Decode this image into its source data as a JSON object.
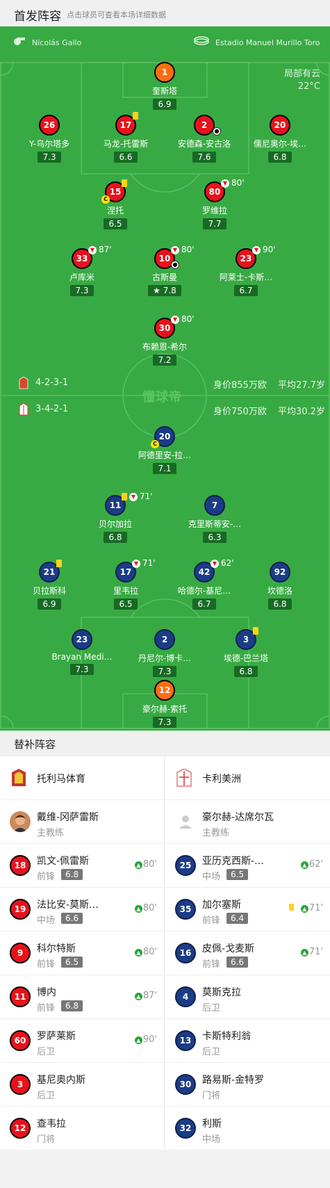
{
  "header": {
    "title": "首发阵容",
    "subtitle": "点击球员可查看本场详细数据"
  },
  "match": {
    "referee": "Nicolás Gallo",
    "stadium": "Estadio Manuel Murillo Toro",
    "weather": "局部有云",
    "temperature": "22°C",
    "watermark": "懂球帝"
  },
  "home_team": {
    "formation": "4-2-3-1",
    "value": "身价855万欧",
    "age": "平均27.7岁"
  },
  "away_team": {
    "formation": "3-4-2-1",
    "value": "身价750万欧",
    "age": "平均30.2岁"
  },
  "home_players": [
    {
      "num": "1",
      "name": "奎斯塔",
      "rating": "6.9"
    },
    {
      "num": "26",
      "name": "Y-乌尔塔多",
      "rating": "7.3"
    },
    {
      "num": "17",
      "name": "马龙-托雷斯",
      "rating": "6.6"
    },
    {
      "num": "2",
      "name": "安德森-安古洛",
      "rating": "7.6"
    },
    {
      "num": "20",
      "name": "儒尼奥尔-埃…",
      "rating": "6.8"
    },
    {
      "num": "15",
      "name": "涅托",
      "rating": "6.5"
    },
    {
      "num": "80",
      "name": "罗维拉",
      "rating": "7.7",
      "sub": "80'"
    },
    {
      "num": "33",
      "name": "卢库米",
      "rating": "7.3",
      "sub": "87'"
    },
    {
      "num": "10",
      "name": "古斯曼",
      "rating": "7.8",
      "sub": "80'"
    },
    {
      "num": "23",
      "name": "阿莱士-卡斯…",
      "rating": "6.7",
      "sub": "90'"
    },
    {
      "num": "30",
      "name": "布赖恩-希尔",
      "rating": "7.2",
      "sub": "80'"
    }
  ],
  "away_players": [
    {
      "num": "20",
      "name": "阿德里安-拉…",
      "rating": "7.1"
    },
    {
      "num": "11",
      "name": "贝尔加拉",
      "rating": "6.8",
      "sub": "71'"
    },
    {
      "num": "7",
      "name": "克里斯蒂安-…",
      "rating": "6.3"
    },
    {
      "num": "21",
      "name": "贝拉斯科",
      "rating": "6.9"
    },
    {
      "num": "17",
      "name": "里韦拉",
      "rating": "6.5",
      "sub": "71'"
    },
    {
      "num": "42",
      "name": "哈德尔-基尼…",
      "rating": "6.7",
      "sub": "62'"
    },
    {
      "num": "92",
      "name": "坎德洛",
      "rating": "6.8"
    },
    {
      "num": "23",
      "name": "Brayan Medi…",
      "rating": "7.3"
    },
    {
      "num": "2",
      "name": "丹尼尔-博卡…",
      "rating": "7.3"
    },
    {
      "num": "3",
      "name": "埃德-巴兰塔",
      "rating": "6.8"
    },
    {
      "num": "12",
      "name": "豪尔赫-索托",
      "rating": "7.3"
    }
  ],
  "subs": {
    "title": "替补阵容",
    "left_team": "托利马体育",
    "right_team": "卡利美洲",
    "left_coach": {
      "name": "戴维-冈萨雷斯",
      "role": "主教练"
    },
    "right_coach": {
      "name": "豪尔赫-达席尔瓦",
      "role": "主教练"
    },
    "left": [
      {
        "num": "18",
        "name": "凯文-佩雷斯",
        "pos": "前锋",
        "rating": "6.8",
        "sub": "80'"
      },
      {
        "num": "19",
        "name": "法比安-莫斯…",
        "pos": "中场",
        "rating": "6.6",
        "sub": "80'"
      },
      {
        "num": "9",
        "name": "科尔特斯",
        "pos": "前锋",
        "rating": "6.5",
        "sub": "80'"
      },
      {
        "num": "11",
        "name": "博内",
        "pos": "前锋",
        "rating": "6.8",
        "sub": "87'"
      },
      {
        "num": "60",
        "name": "罗萨莱斯",
        "pos": "后卫",
        "sub": "90'"
      },
      {
        "num": "3",
        "name": "基尼奥内斯",
        "pos": "后卫"
      },
      {
        "num": "12",
        "name": "查韦拉",
        "pos": "门将"
      }
    ],
    "right": [
      {
        "num": "25",
        "name": "亚历克西斯-…",
        "pos": "中场",
        "rating": "6.5",
        "sub": "62'"
      },
      {
        "num": "35",
        "name": "加尔塞斯",
        "pos": "前锋",
        "rating": "6.4",
        "sub": "71'"
      },
      {
        "num": "16",
        "name": "皮佩-戈麦斯",
        "pos": "前锋",
        "rating": "6.6",
        "sub": "71'"
      },
      {
        "num": "4",
        "name": "莫斯克拉",
        "pos": "后卫"
      },
      {
        "num": "13",
        "name": "卡斯特利翁",
        "pos": "后卫"
      },
      {
        "num": "30",
        "name": "路易斯-金特罗",
        "pos": "门将"
      },
      {
        "num": "32",
        "name": "利斯",
        "pos": "中场"
      }
    ]
  },
  "colors": {
    "pitch": "#38aa43",
    "home": "#e8121b",
    "away": "#1b3d86",
    "keeper": "#ff6d10",
    "card": "#ffd21a",
    "sub_in": "#23a834"
  }
}
